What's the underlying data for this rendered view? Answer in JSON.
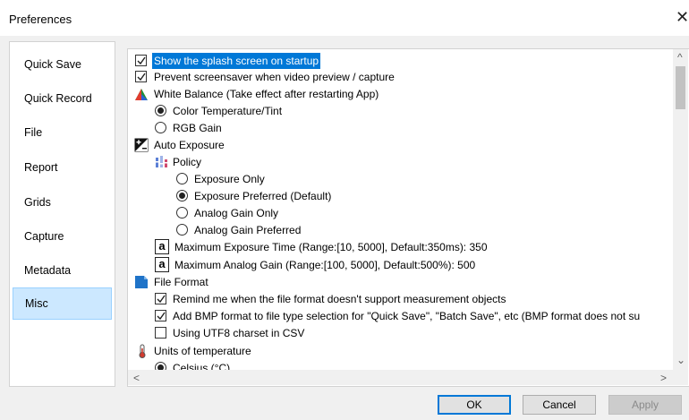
{
  "window": {
    "title": "Preferences",
    "close_glyph": "✕"
  },
  "nav": {
    "items": [
      {
        "label": "Quick Save"
      },
      {
        "label": "Quick Record"
      },
      {
        "label": "File"
      },
      {
        "label": "Report"
      },
      {
        "label": "Grids"
      },
      {
        "label": "Capture"
      },
      {
        "label": "Metadata"
      },
      {
        "label": "Misc",
        "selected": true
      }
    ]
  },
  "options": {
    "splash": {
      "label": "Show the splash screen on startup",
      "checked": true
    },
    "screensaver": {
      "label": "Prevent screensaver when video preview / capture",
      "checked": true
    },
    "white_balance": {
      "label": "White Balance (Take effect after restarting App)",
      "icon": "white-balance-icon",
      "options": [
        {
          "label": "Color Temperature/Tint",
          "selected": true
        },
        {
          "label": "RGB Gain",
          "selected": false
        }
      ]
    },
    "auto_exposure": {
      "label": "Auto Exposure",
      "icon": "exposure-icon",
      "policy": {
        "label": "Policy",
        "icon": "policy-icon",
        "options": [
          {
            "label": "Exposure Only",
            "selected": false
          },
          {
            "label": "Exposure Preferred (Default)",
            "selected": true
          },
          {
            "label": "Analog Gain Only",
            "selected": false
          },
          {
            "label": "Analog Gain Preferred",
            "selected": false
          }
        ]
      },
      "max_exposure": {
        "icon_glyph": "a",
        "label": "Maximum Exposure Time (Range:[10, 5000], Default:350ms): 350"
      },
      "max_gain": {
        "icon_glyph": "a",
        "label": "Maximum Analog Gain (Range:[100, 5000], Default:500%): 500"
      }
    },
    "file_format": {
      "label": "File Format",
      "icon": "file-format-icon",
      "items": [
        {
          "label": "Remind me when the file format doesn't support measurement objects",
          "checked": true
        },
        {
          "label": "Add BMP format to file type selection for \"Quick Save\", \"Batch Save\", etc (BMP format does not su",
          "checked": true
        },
        {
          "label": "Using UTF8 charset in CSV",
          "checked": false
        }
      ]
    },
    "units_temperature": {
      "label": "Units of temperature",
      "icon": "thermometer-icon",
      "partial_option": "Celsius (°C)"
    }
  },
  "scroll": {
    "up": "^",
    "down": "⌄",
    "left": "<",
    "right": ">"
  },
  "buttons": {
    "ok": "OK",
    "cancel": "Cancel",
    "apply": "Apply"
  },
  "colors": {
    "selection": "#0078d7",
    "nav_selected": "#cce8ff"
  }
}
